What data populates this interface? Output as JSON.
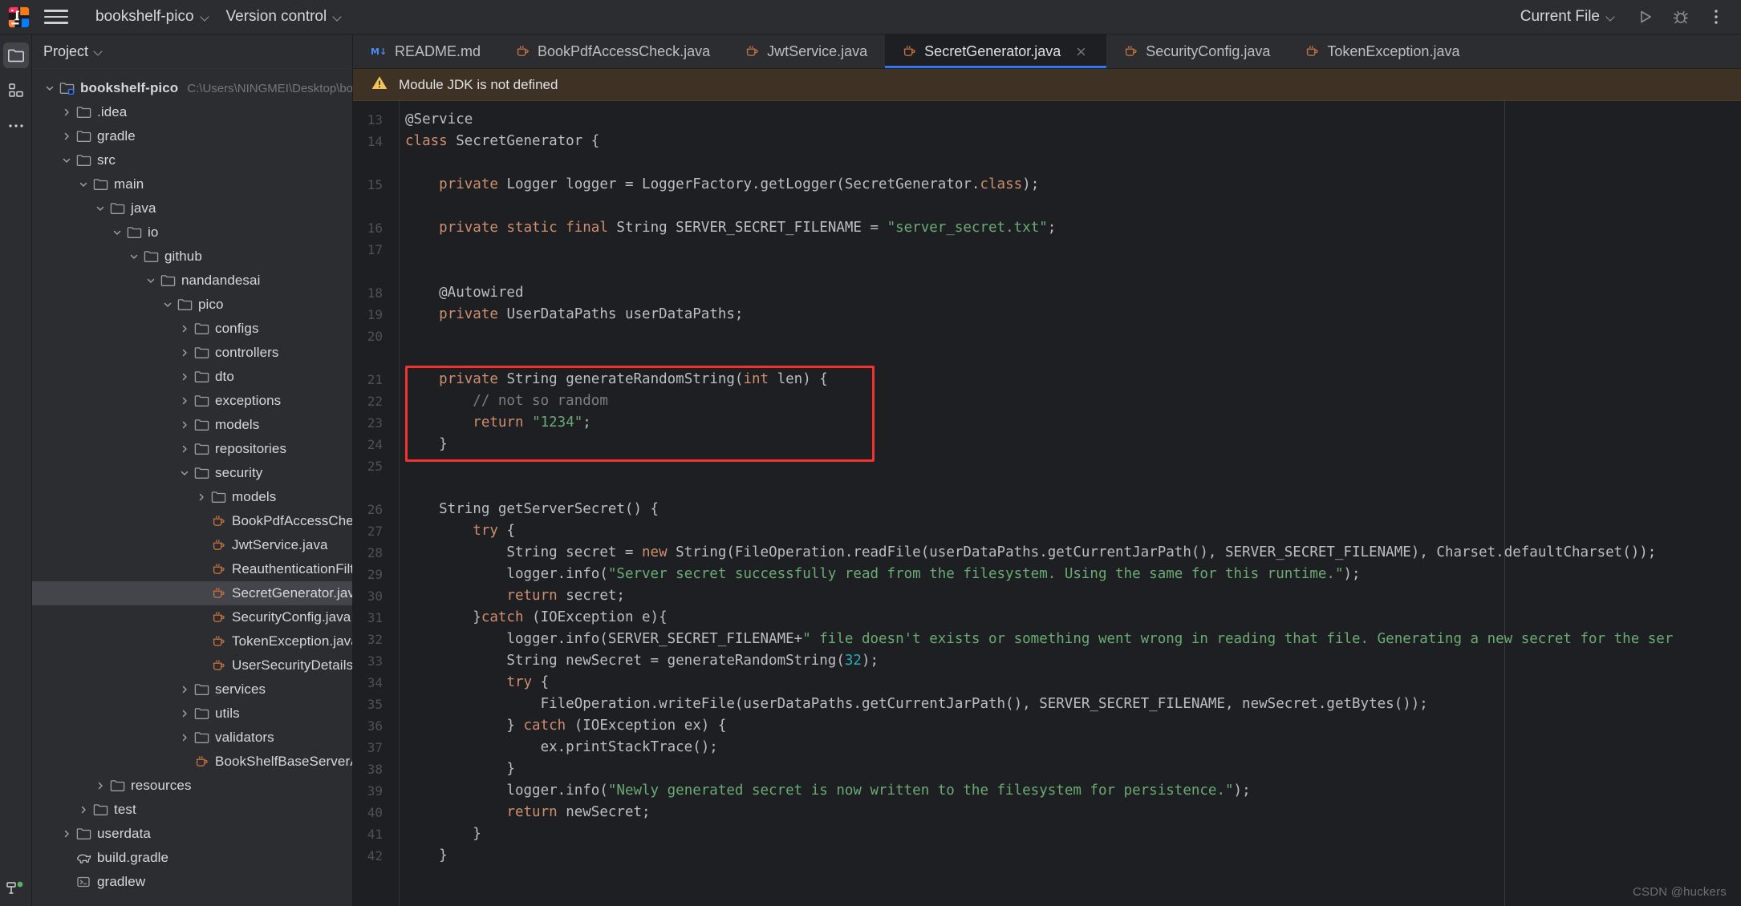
{
  "titlebar": {
    "logo_icon": "intellij-idea-logo",
    "menu_icon": "hamburger-menu-icon",
    "project_name": "bookshelf-pico",
    "vcs_label": "Version control",
    "run_config_label": "Current File",
    "run_icon": "run-triangle-icon",
    "debug_icon": "debug-bug-icon",
    "more_icon": "more-vertical-dots-icon"
  },
  "rail": {
    "items": [
      {
        "name": "project-tool-window",
        "icon": "folder-icon",
        "active": true
      },
      {
        "name": "structure-tool-window",
        "icon": "structure-blocks-icon",
        "active": false
      },
      {
        "name": "more-tool-windows",
        "icon": "more-horizontal-dots-icon",
        "active": false
      }
    ],
    "bottom_icon": "terminal-plug-icon"
  },
  "project_panel": {
    "title": "Project",
    "title_chevron_icon": "chevron-down-icon",
    "tree": [
      {
        "label": "bookshelf-pico",
        "path": "C:\\Users\\NINGMEI\\Desktop\\bookshelf-pico",
        "depth": 0,
        "icon": "module-folder-icon",
        "state": "expanded",
        "bold": true
      },
      {
        "label": ".idea",
        "depth": 1,
        "icon": "folder-icon",
        "state": "collapsed"
      },
      {
        "label": "gradle",
        "depth": 1,
        "icon": "folder-icon",
        "state": "collapsed"
      },
      {
        "label": "src",
        "depth": 1,
        "icon": "folder-icon",
        "state": "expanded"
      },
      {
        "label": "main",
        "depth": 2,
        "icon": "folder-icon",
        "state": "expanded"
      },
      {
        "label": "java",
        "depth": 3,
        "icon": "folder-icon",
        "state": "expanded"
      },
      {
        "label": "io",
        "depth": 4,
        "icon": "folder-icon",
        "state": "expanded"
      },
      {
        "label": "github",
        "depth": 5,
        "icon": "folder-icon",
        "state": "expanded"
      },
      {
        "label": "nandandesai",
        "depth": 6,
        "icon": "folder-icon",
        "state": "expanded"
      },
      {
        "label": "pico",
        "depth": 7,
        "icon": "folder-icon",
        "state": "expanded"
      },
      {
        "label": "configs",
        "depth": 8,
        "icon": "folder-icon",
        "state": "collapsed"
      },
      {
        "label": "controllers",
        "depth": 8,
        "icon": "folder-icon",
        "state": "collapsed"
      },
      {
        "label": "dto",
        "depth": 8,
        "icon": "folder-icon",
        "state": "collapsed"
      },
      {
        "label": "exceptions",
        "depth": 8,
        "icon": "folder-icon",
        "state": "collapsed"
      },
      {
        "label": "models",
        "depth": 8,
        "icon": "folder-icon",
        "state": "collapsed"
      },
      {
        "label": "repositories",
        "depth": 8,
        "icon": "folder-icon",
        "state": "collapsed"
      },
      {
        "label": "security",
        "depth": 8,
        "icon": "folder-icon",
        "state": "expanded"
      },
      {
        "label": "models",
        "depth": 9,
        "icon": "folder-icon",
        "state": "collapsed"
      },
      {
        "label": "BookPdfAccessCheck.java",
        "depth": 9,
        "icon": "java-class-icon",
        "state": "leaf"
      },
      {
        "label": "JwtService.java",
        "depth": 9,
        "icon": "java-class-icon",
        "state": "leaf"
      },
      {
        "label": "ReauthenticationFilter.java",
        "depth": 9,
        "icon": "java-class-icon",
        "state": "leaf"
      },
      {
        "label": "SecretGenerator.java",
        "depth": 9,
        "icon": "java-class-icon",
        "state": "leaf",
        "selected": true
      },
      {
        "label": "SecurityConfig.java",
        "depth": 9,
        "icon": "java-class-icon",
        "state": "leaf"
      },
      {
        "label": "TokenException.java",
        "depth": 9,
        "icon": "java-class-icon",
        "state": "leaf"
      },
      {
        "label": "UserSecurityDetailsService.java",
        "depth": 9,
        "icon": "java-class-icon",
        "state": "leaf"
      },
      {
        "label": "services",
        "depth": 8,
        "icon": "folder-icon",
        "state": "collapsed"
      },
      {
        "label": "utils",
        "depth": 8,
        "icon": "folder-icon",
        "state": "collapsed"
      },
      {
        "label": "validators",
        "depth": 8,
        "icon": "folder-icon",
        "state": "collapsed"
      },
      {
        "label": "BookShelfBaseServerApplication.java",
        "depth": 8,
        "icon": "java-class-icon",
        "state": "leaf"
      },
      {
        "label": "resources",
        "depth": 3,
        "icon": "folder-icon",
        "state": "collapsed"
      },
      {
        "label": "test",
        "depth": 2,
        "icon": "folder-icon",
        "state": "collapsed"
      },
      {
        "label": "userdata",
        "depth": 1,
        "icon": "folder-icon",
        "state": "collapsed"
      },
      {
        "label": "build.gradle",
        "depth": 1,
        "icon": "gradle-elephant-icon",
        "state": "leaf"
      },
      {
        "label": "gradlew",
        "depth": 1,
        "icon": "shell-script-icon",
        "state": "leaf"
      }
    ]
  },
  "editor": {
    "tabs": [
      {
        "label": "README.md",
        "icon": "markdown-icon",
        "active": false,
        "closable": false
      },
      {
        "label": "BookPdfAccessCheck.java",
        "icon": "java-file-icon",
        "active": false,
        "closable": false
      },
      {
        "label": "JwtService.java",
        "icon": "java-file-icon",
        "active": false,
        "closable": false
      },
      {
        "label": "SecretGenerator.java",
        "icon": "java-class-icon",
        "active": true,
        "closable": true,
        "close_icon": "close-x-icon"
      },
      {
        "label": "SecurityConfig.java",
        "icon": "java-file-icon",
        "active": false,
        "closable": false
      },
      {
        "label": "TokenException.java",
        "icon": "java-file-icon",
        "active": false,
        "closable": false
      }
    ],
    "notification": {
      "icon": "warning-triangle-icon",
      "text": "Module JDK is not defined"
    },
    "highlight_color": "#f5312e",
    "accent_color": "#3574f0",
    "lines": [
      {
        "n": "13",
        "tokens": [
          {
            "t": "@Service",
            "c": "anno"
          }
        ]
      },
      {
        "n": "14",
        "tokens": [
          {
            "t": "class ",
            "c": "kw"
          },
          {
            "t": "SecretGenerator {",
            "c": "plain"
          }
        ]
      },
      {
        "n": "",
        "tokens": []
      },
      {
        "n": "15",
        "tokens": [
          {
            "t": "    ",
            "c": "plain"
          },
          {
            "t": "private ",
            "c": "kw"
          },
          {
            "t": "Logger logger = LoggerFactory.getLogger(SecretGenerator.",
            "c": "plain"
          },
          {
            "t": "class",
            "c": "kw"
          },
          {
            "t": ");",
            "c": "plain"
          }
        ]
      },
      {
        "n": "",
        "tokens": []
      },
      {
        "n": "16",
        "tokens": [
          {
            "t": "    ",
            "c": "plain"
          },
          {
            "t": "private static final ",
            "c": "kw"
          },
          {
            "t": "String SERVER_SECRET_FILENAME = ",
            "c": "plain"
          },
          {
            "t": "\"server_secret.txt\"",
            "c": "str"
          },
          {
            "t": ";",
            "c": "plain"
          }
        ]
      },
      {
        "n": "17",
        "tokens": []
      },
      {
        "n": "",
        "tokens": []
      },
      {
        "n": "18",
        "tokens": [
          {
            "t": "    @Autowired",
            "c": "anno"
          }
        ]
      },
      {
        "n": "19",
        "tokens": [
          {
            "t": "    ",
            "c": "plain"
          },
          {
            "t": "private ",
            "c": "kw"
          },
          {
            "t": "UserDataPaths userDataPaths;",
            "c": "plain"
          }
        ]
      },
      {
        "n": "20",
        "tokens": []
      },
      {
        "n": "",
        "tokens": []
      },
      {
        "n": "21",
        "tokens": [
          {
            "t": "    ",
            "c": "plain"
          },
          {
            "t": "private ",
            "c": "kw"
          },
          {
            "t": "String generateRandomString(",
            "c": "plain"
          },
          {
            "t": "int",
            "c": "kw"
          },
          {
            "t": " len) {",
            "c": "plain"
          }
        ]
      },
      {
        "n": "22",
        "tokens": [
          {
            "t": "        // not so random",
            "c": "cmt"
          }
        ]
      },
      {
        "n": "23",
        "tokens": [
          {
            "t": "        ",
            "c": "plain"
          },
          {
            "t": "return ",
            "c": "kw"
          },
          {
            "t": "\"1234\"",
            "c": "str"
          },
          {
            "t": ";",
            "c": "plain"
          }
        ]
      },
      {
        "n": "24",
        "tokens": [
          {
            "t": "    }",
            "c": "plain"
          }
        ]
      },
      {
        "n": "25",
        "tokens": []
      },
      {
        "n": "",
        "tokens": []
      },
      {
        "n": "26",
        "tokens": [
          {
            "t": "    String getServerSecret() {",
            "c": "plain"
          }
        ]
      },
      {
        "n": "27",
        "tokens": [
          {
            "t": "        ",
            "c": "plain"
          },
          {
            "t": "try",
            "c": "kw"
          },
          {
            "t": " {",
            "c": "plain"
          }
        ]
      },
      {
        "n": "28",
        "tokens": [
          {
            "t": "            String secret = ",
            "c": "plain"
          },
          {
            "t": "new ",
            "c": "kw"
          },
          {
            "t": "String(FileOperation.readFile(userDataPaths.getCurrentJarPath(), SERVER_SECRET_FILENAME), Charset.defaultCharset());",
            "c": "plain"
          }
        ]
      },
      {
        "n": "29",
        "tokens": [
          {
            "t": "            logger.info(",
            "c": "plain"
          },
          {
            "t": "\"Server secret successfully read from the filesystem. Using the same for this runtime.\"",
            "c": "str"
          },
          {
            "t": ");",
            "c": "plain"
          }
        ]
      },
      {
        "n": "30",
        "tokens": [
          {
            "t": "            ",
            "c": "plain"
          },
          {
            "t": "return ",
            "c": "kw"
          },
          {
            "t": "secret;",
            "c": "plain"
          }
        ]
      },
      {
        "n": "31",
        "tokens": [
          {
            "t": "        }",
            "c": "plain"
          },
          {
            "t": "catch",
            "c": "kw"
          },
          {
            "t": " (IOException e){",
            "c": "plain"
          }
        ]
      },
      {
        "n": "32",
        "tokens": [
          {
            "t": "            logger.info(SERVER_SECRET_FILENAME+",
            "c": "plain"
          },
          {
            "t": "\" file doesn't exists or something went wrong in reading that file. Generating a new secret for the ser",
            "c": "str"
          }
        ]
      },
      {
        "n": "33",
        "tokens": [
          {
            "t": "            String newSecret = generateRandomString(",
            "c": "plain"
          },
          {
            "t": "32",
            "c": "num"
          },
          {
            "t": ");",
            "c": "plain"
          }
        ]
      },
      {
        "n": "34",
        "tokens": [
          {
            "t": "            ",
            "c": "plain"
          },
          {
            "t": "try",
            "c": "kw"
          },
          {
            "t": " {",
            "c": "plain"
          }
        ]
      },
      {
        "n": "35",
        "tokens": [
          {
            "t": "                FileOperation.writeFile(userDataPaths.getCurrentJarPath(), SERVER_SECRET_FILENAME, newSecret.getBytes());",
            "c": "plain"
          }
        ]
      },
      {
        "n": "36",
        "tokens": [
          {
            "t": "            } ",
            "c": "plain"
          },
          {
            "t": "catch",
            "c": "kw"
          },
          {
            "t": " (IOException ex) {",
            "c": "plain"
          }
        ]
      },
      {
        "n": "37",
        "tokens": [
          {
            "t": "                ex.printStackTrace();",
            "c": "plain"
          }
        ]
      },
      {
        "n": "38",
        "tokens": [
          {
            "t": "            }",
            "c": "plain"
          }
        ]
      },
      {
        "n": "39",
        "tokens": [
          {
            "t": "            logger.info(",
            "c": "plain"
          },
          {
            "t": "\"Newly generated secret is now written to the filesystem for persistence.\"",
            "c": "str"
          },
          {
            "t": ");",
            "c": "plain"
          }
        ]
      },
      {
        "n": "40",
        "tokens": [
          {
            "t": "            ",
            "c": "plain"
          },
          {
            "t": "return ",
            "c": "kw"
          },
          {
            "t": "newSecret;",
            "c": "plain"
          }
        ]
      },
      {
        "n": "41",
        "tokens": [
          {
            "t": "        }",
            "c": "plain"
          }
        ]
      },
      {
        "n": "42",
        "tokens": [
          {
            "t": "    }",
            "c": "plain"
          }
        ]
      }
    ]
  },
  "watermark": "CSDN @huckers"
}
